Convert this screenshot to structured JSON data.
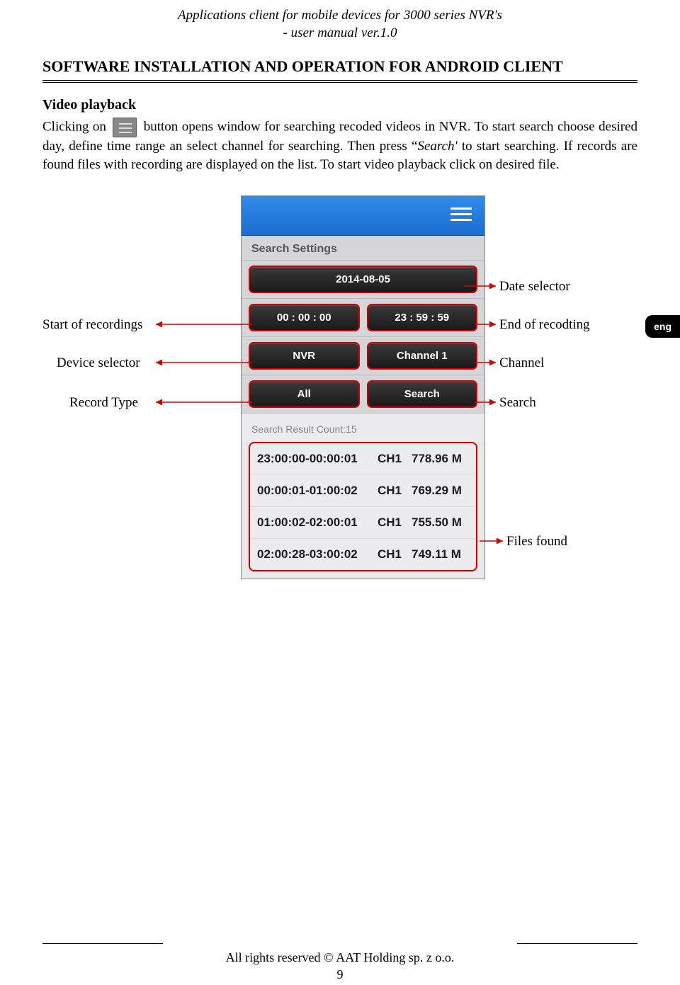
{
  "header": {
    "line1": "Applications client for mobile devices for 3000 series NVR's",
    "line2": "- user manual ver.1.0"
  },
  "section_title": "SOFTWARE INSTALLATION AND OPERATION FOR ANDROID CLIENT",
  "subsection": "Video playback",
  "body": {
    "p1a": "Clicking on ",
    "p1b": " button opens window for searching recoded videos in NVR. To start search choose desired day, define time range an select channel for searching. Then press “",
    "p1c_italic": "Search'",
    "p1d": " to start searching. If records are found files with recording are displayed on the list. To start video playback click on desired file."
  },
  "tab": {
    "eng": "eng"
  },
  "shot": {
    "ss_title": "Search Settings",
    "date": "2014-08-05",
    "time_from": "00 : 00 : 00",
    "time_to": "23 : 59 : 59",
    "device": "NVR",
    "channel": "Channel 1",
    "rtype": "All",
    "search": "Search",
    "result_count": "Search Result Count:15",
    "results": [
      {
        "time": "23:00:00-00:00:01",
        "ch": "CH1",
        "size": "778.96 M"
      },
      {
        "time": "00:00:01-01:00:02",
        "ch": "CH1",
        "size": "769.29 M"
      },
      {
        "time": "01:00:02-02:00:01",
        "ch": "CH1",
        "size": "755.50 M"
      },
      {
        "time": "02:00:28-03:00:02",
        "ch": "CH1",
        "size": "749.11 M"
      }
    ]
  },
  "callouts": {
    "date": "Date selector",
    "start": "Start of recordings",
    "end": "End of recodting",
    "device": "Device selector",
    "channel": "Channel",
    "rtype": "Record Type",
    "search": "Search",
    "files": "Files found"
  },
  "footer": {
    "rights": "All rights reserved © AAT Holding sp. z o.o.",
    "page": "9"
  }
}
